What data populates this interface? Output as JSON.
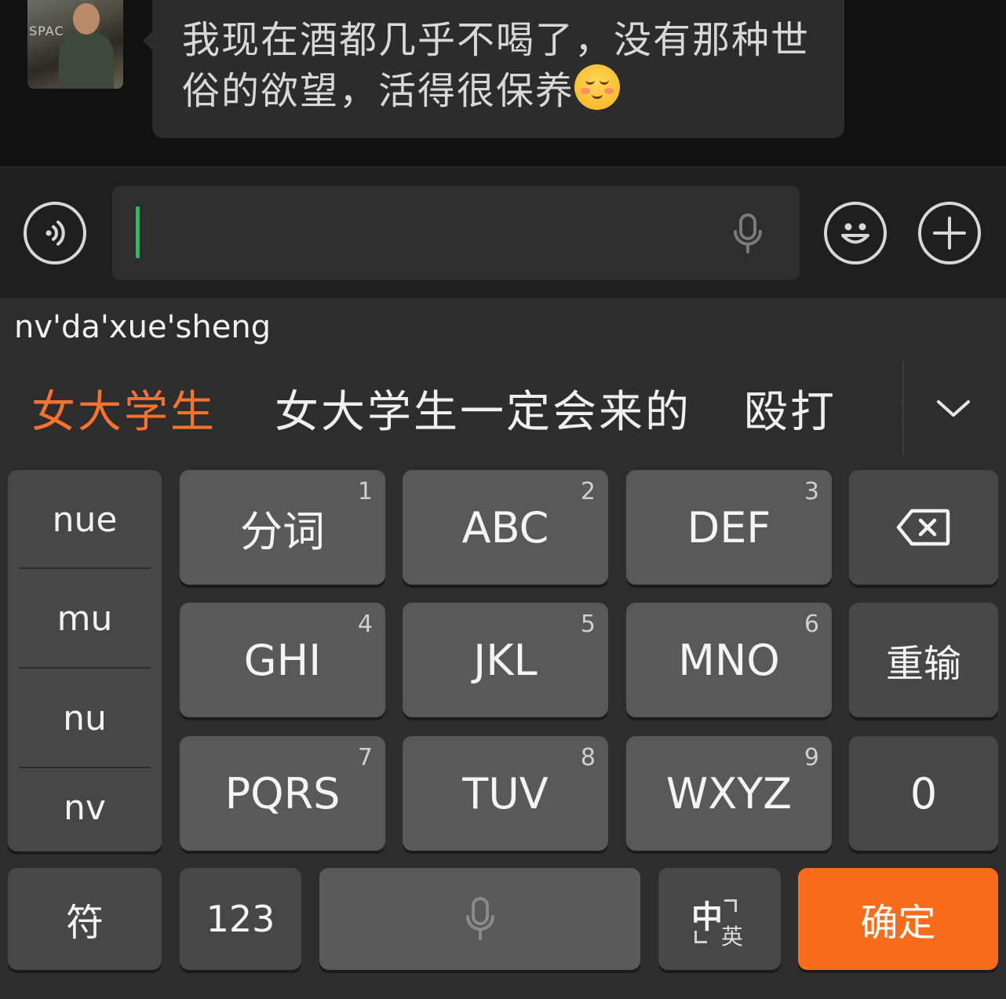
{
  "chat": {
    "avatar_text": "SPAC",
    "message": "我现在酒都几乎不喝了，没有那种世俗的欲望，活得很保养",
    "message_emoji": "shy-smile-emoji"
  },
  "input_bar": {
    "voice_icon": "voice-mode-icon",
    "text_value": "",
    "mic_icon": "microphone-icon",
    "emoji_icon": "emoji-icon",
    "plus_icon": "plus-icon"
  },
  "keyboard": {
    "composing_pinyin": "nv'da'xue'sheng",
    "candidates": [
      "女大学生",
      "女大学生一定会来的",
      "殴打",
      "："
    ],
    "expand_icon": "chevron-down-icon",
    "syllables": [
      "nue",
      "mu",
      "nu",
      "nv"
    ],
    "keys": [
      {
        "label": "分词",
        "num": "1"
      },
      {
        "label": "ABC",
        "num": "2"
      },
      {
        "label": "DEF",
        "num": "3"
      },
      {
        "label": "GHI",
        "num": "4"
      },
      {
        "label": "JKL",
        "num": "5"
      },
      {
        "label": "MNO",
        "num": "6"
      },
      {
        "label": "PQRS",
        "num": "7"
      },
      {
        "label": "TUV",
        "num": "8"
      },
      {
        "label": "WXYZ",
        "num": "9"
      }
    ],
    "backspace_icon": "backspace-icon",
    "reinput_label": "重输",
    "zero_label": "0",
    "symbol_label": "符",
    "numeric_label": "123",
    "space_icon": "microphone-icon",
    "lang_zh": "中",
    "lang_en": "英",
    "confirm_label": "确定",
    "accent_color": "#f86c1a"
  }
}
